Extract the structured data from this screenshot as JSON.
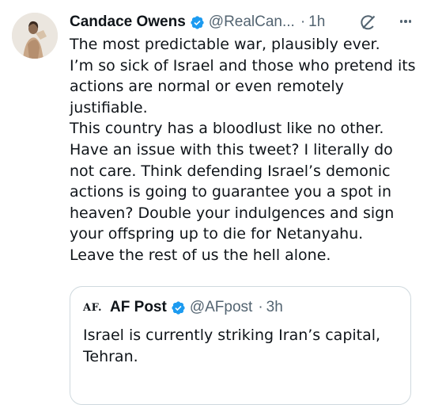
{
  "tweet": {
    "author_name": "Candace Owens",
    "author_handle": "@RealCan...",
    "separator": "·",
    "time": "1h",
    "body_lines": [
      "The most predictable war, plausibly ever.",
      "I’m so sick of Israel and those who pretend its",
      "actions are normal or even remotely",
      "justifiable.",
      "This country has a bloodlust like no other.",
      "Have an issue with this tweet? I literally do",
      "not care. Think defending Israel’s demonic",
      "actions is going to guarantee you a spot in",
      "heaven? Double your indulgences and sign",
      "your offspring up to die for Netanyahu.",
      "Leave the rest of us the hell alone."
    ]
  },
  "quote": {
    "logo_text": "AF.",
    "author_name": "AF Post",
    "author_handle": "@AFpost",
    "separator": "·",
    "time": "3h",
    "body_lines": [
      "Israel is currently striking Iran’s capital,",
      "Tehran."
    ]
  },
  "icons": {
    "verified": "verified-badge-icon",
    "grok": "grok-icon",
    "more": "more-options-icon"
  },
  "colors": {
    "verified_blue": "#1d9bf0",
    "secondary_text": "#536471",
    "primary_text": "#0f1419",
    "border": "#cfd9de"
  }
}
